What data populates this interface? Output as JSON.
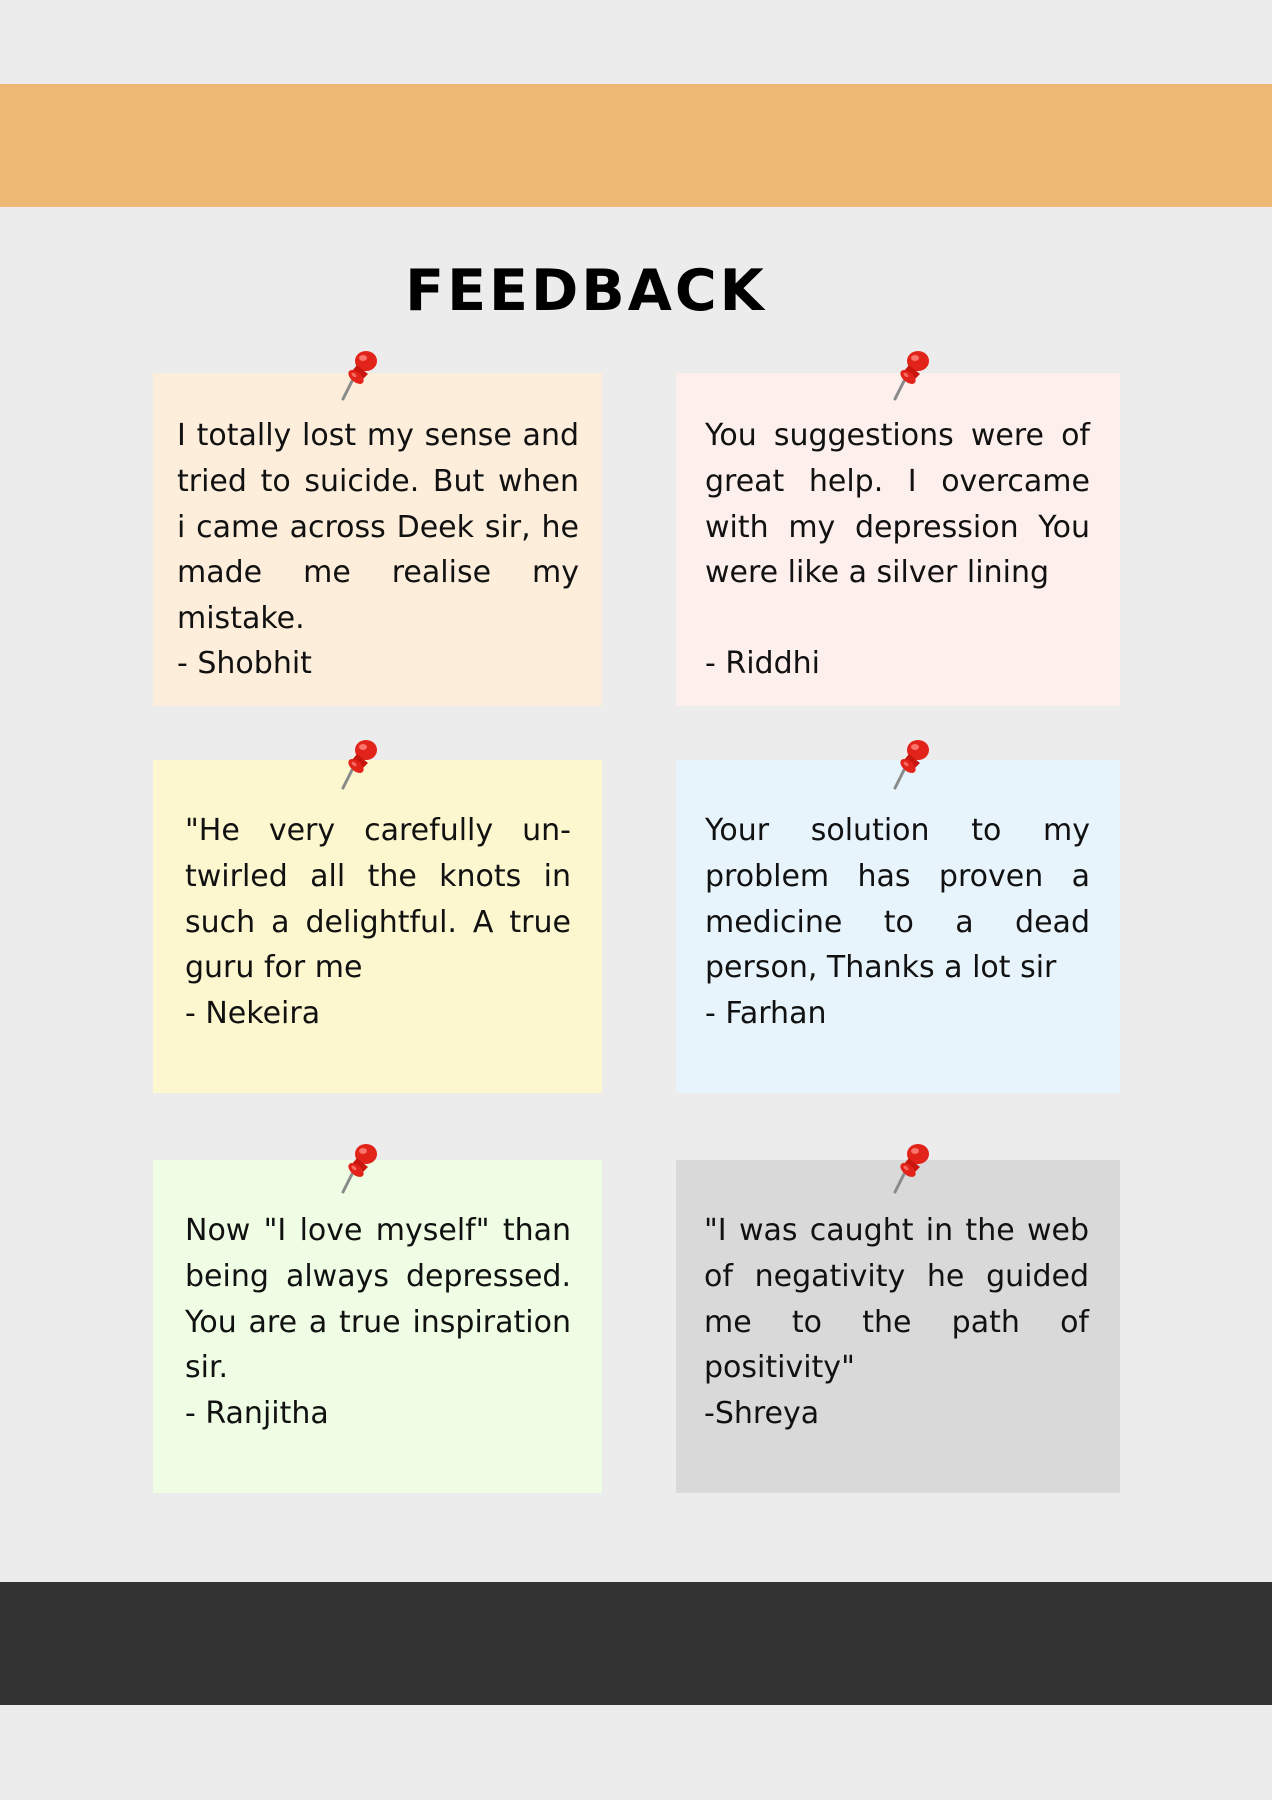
{
  "page": {
    "title": "FEEDBACK",
    "top_band_color": "#ecb874",
    "bottom_band_color": "#333333",
    "background_color": "#ececec"
  },
  "notes": [
    {
      "text": "I totally lost my sense and tried to suicide. But when i came across Deek sir, he made me realise my mistake.",
      "author": "- Shobhit",
      "color": "#fdeedb",
      "pin_icon": "pushpin-icon"
    },
    {
      "text": "You suggestions were of great help. I overcame with my depression You were like a silver lining",
      "author": "- Riddhi",
      "color": "#fcefec",
      "pin_icon": "pushpin-icon"
    },
    {
      "text": "\"He very carefully un-twirled all the knots in such a delightful. A true guru for me",
      "author": "- Nekeira",
      "color": "#fdf7cf",
      "pin_icon": "pushpin-icon"
    },
    {
      "text": "Your solution to my problem has proven a medicine to a dead person, Thanks a lot sir",
      "author": "- Farhan",
      "color": "#e8f4fc",
      "pin_icon": "pushpin-icon"
    },
    {
      "text": "Now \"I love myself\" than being always depressed. You are a true inspiration sir.",
      "author": "- Ranjitha",
      "color": "#eefde3",
      "pin_icon": "pushpin-icon"
    },
    {
      "text": "\"I was caught in the web of negativity he guided me to the path of positivity\"",
      "author": "-Shreya",
      "color": "#d9d9d9",
      "pin_icon": "pushpin-icon"
    }
  ]
}
